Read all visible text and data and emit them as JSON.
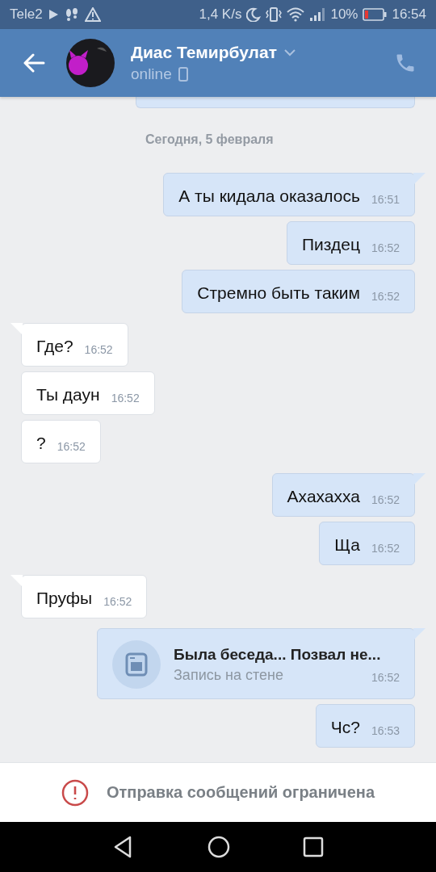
{
  "status_bar": {
    "carrier": "Tele2",
    "speed": "1,4 K/s",
    "battery": "10%",
    "time": "16:54"
  },
  "header": {
    "name": "Диас Темирбулат",
    "status": "online"
  },
  "date_label": "Сегодня, 5 февраля",
  "messages": [
    {
      "kind": "text",
      "outgoing": true,
      "tail": true,
      "text": "А ты кидала оказалось",
      "time": "16:51"
    },
    {
      "kind": "text",
      "outgoing": true,
      "tail": false,
      "text": "Пиздец",
      "time": "16:52"
    },
    {
      "kind": "text",
      "outgoing": true,
      "tail": false,
      "text": "Стремно быть таким",
      "time": "16:52"
    },
    {
      "kind": "text",
      "outgoing": false,
      "tail": true,
      "text": "Где?",
      "time": "16:52"
    },
    {
      "kind": "text",
      "outgoing": false,
      "tail": false,
      "text": "Ты даун",
      "time": "16:52"
    },
    {
      "kind": "text",
      "outgoing": false,
      "tail": false,
      "text": "?",
      "time": "16:52"
    },
    {
      "kind": "text",
      "outgoing": true,
      "tail": true,
      "text": "Ахахахха",
      "time": "16:52"
    },
    {
      "kind": "text",
      "outgoing": true,
      "tail": false,
      "text": "Ща",
      "time": "16:52"
    },
    {
      "kind": "text",
      "outgoing": false,
      "tail": true,
      "text": "Пруфы",
      "time": "16:52"
    },
    {
      "kind": "post",
      "outgoing": true,
      "tail": true,
      "text": "Была беседа... Позвал не...",
      "subtitle": "Запись на стене",
      "time": "16:52"
    },
    {
      "kind": "text",
      "outgoing": true,
      "tail": false,
      "text": "Чс?",
      "time": "16:53"
    }
  ],
  "notice": "Отправка сообщений ограничена"
}
